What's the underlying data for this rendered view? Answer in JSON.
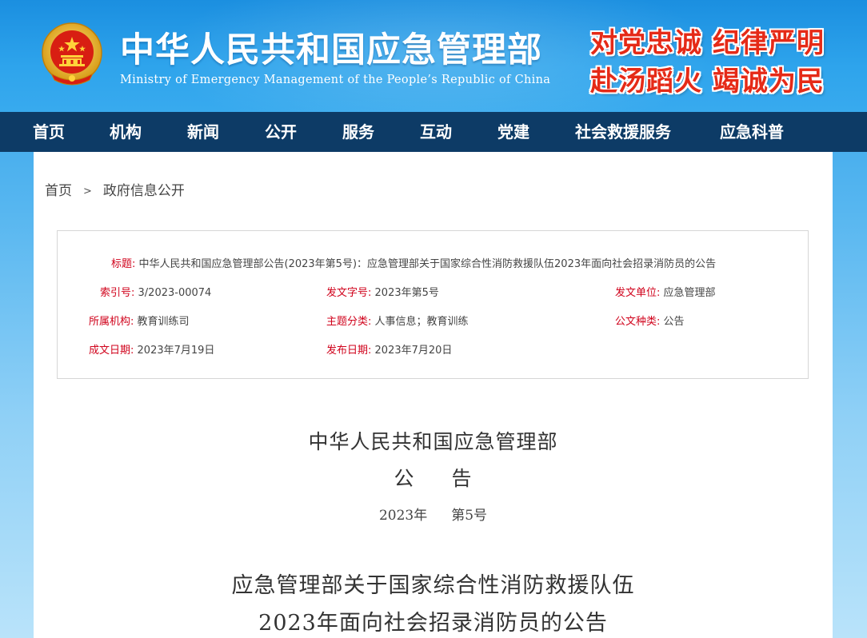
{
  "header": {
    "title": "中华人民共和国应急管理部",
    "subtitle": "Ministry of Emergency Management of the People’s Republic of China",
    "slogan_line1": "对党忠诚 纪律严明",
    "slogan_line2": "赴汤蹈火 竭诚为民",
    "emblem_icon": "national-emblem-icon"
  },
  "colors": {
    "header_blue": "#1b8fe0",
    "nav_dark": "#0d3b66",
    "label_red": "#d0021b",
    "slogan_red": "#e52a17"
  },
  "nav": {
    "items": [
      {
        "label": "首页"
      },
      {
        "label": "机构"
      },
      {
        "label": "新闻"
      },
      {
        "label": "公开"
      },
      {
        "label": "服务"
      },
      {
        "label": "互动"
      },
      {
        "label": "党建"
      },
      {
        "label": "社会救援服务"
      },
      {
        "label": "应急科普"
      }
    ]
  },
  "breadcrumb": {
    "home": "首页",
    "separator": ">",
    "current": "政府信息公开"
  },
  "meta": {
    "title_label": "标题:",
    "title_value": "中华人民共和国应急管理部公告(2023年第5号)：应急管理部关于国家综合性消防救援队伍2023年面向社会招录消防员的公告",
    "index_label": "索引号:",
    "index_value": "3/2023-00074",
    "docno_label": "发文字号:",
    "docno_value": "2023年第5号",
    "issuer_label": "发文单位:",
    "issuer_value": "应急管理部",
    "org_label": "所属机构:",
    "org_value": "教育训练司",
    "topic_label": "主题分类:",
    "topic_value": "人事信息；教育训练",
    "type_label": "公文种类:",
    "type_value": "公告",
    "written_label": "成文日期:",
    "written_value": "2023年7月19日",
    "published_label": "发布日期:",
    "published_value": "2023年7月20日"
  },
  "document": {
    "org": "中华人民共和国应急管理部",
    "kind_char1": "公",
    "kind_char2": "告",
    "year": "2023年",
    "number": "第5号",
    "title_line1": "应急管理部关于国家综合性消防救援队伍",
    "title_line2": "2023年面向社会招录消防员的公告"
  }
}
